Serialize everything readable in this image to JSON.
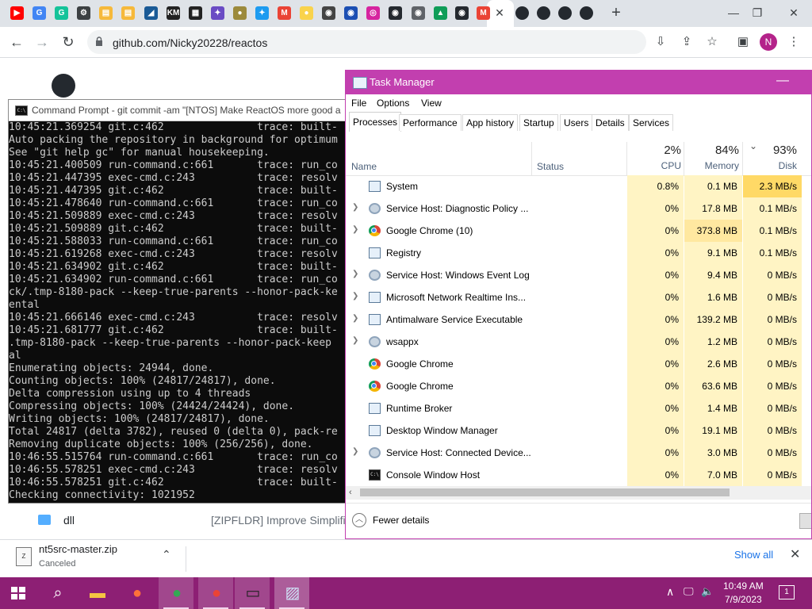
{
  "browser": {
    "tab_icons": [
      {
        "name": "youtube-icon",
        "color": "#ff0000",
        "glyph": "▶"
      },
      {
        "name": "google-icon",
        "color": "#4285f4",
        "glyph": "G"
      },
      {
        "name": "grammarly-icon",
        "color": "#15c39a",
        "glyph": "G"
      },
      {
        "name": "settings-icon",
        "color": "#3c4043",
        "glyph": "⚙"
      },
      {
        "name": "folder-icon",
        "color": "#f6b93b",
        "glyph": "▤"
      },
      {
        "name": "folder-icon",
        "color": "#f6b93b",
        "glyph": "▤"
      },
      {
        "name": "app-icon",
        "color": "#1a5a96",
        "glyph": "◢"
      },
      {
        "name": "kim-icon",
        "color": "#222222",
        "glyph": "KM"
      },
      {
        "name": "qr-icon",
        "color": "#222222",
        "glyph": "▦"
      },
      {
        "name": "star-icon",
        "color": "#6a4bc4",
        "glyph": "✦"
      },
      {
        "name": "hub-icon",
        "color": "#9c8a3c",
        "glyph": "●"
      },
      {
        "name": "twitter-icon",
        "color": "#1d9bf0",
        "glyph": "✦"
      },
      {
        "name": "gmail-icon",
        "color": "#ea4335",
        "glyph": "M"
      },
      {
        "name": "bulb-icon",
        "color": "#f9d34c",
        "glyph": "●"
      },
      {
        "name": "game-icon",
        "color": "#444444",
        "glyph": "◉"
      },
      {
        "name": "sonic-icon",
        "color": "#1c4fb3",
        "glyph": "◉"
      },
      {
        "name": "instagram-icon",
        "color": "#d6249f",
        "glyph": "◎"
      },
      {
        "name": "github-icon",
        "color": "#24292f",
        "glyph": "◉"
      },
      {
        "name": "chrome-icon",
        "color": "#5f6368",
        "glyph": "◉"
      },
      {
        "name": "drive-icon",
        "color": "#0f9d58",
        "glyph": "▲"
      },
      {
        "name": "github-icon",
        "color": "#24292f",
        "glyph": "◉"
      },
      {
        "name": "gmail-icon",
        "color": "#ea4335",
        "glyph": "M"
      }
    ],
    "trailing_github_tabs": 4,
    "close_glyph": "✕",
    "new_tab_glyph": "+",
    "window_controls": {
      "minimize": "—",
      "restore": "❐",
      "close": "✕"
    },
    "url": "github.com/Nicky20228/reactos",
    "profile_initial": "N"
  },
  "github": {
    "row_name": "dll",
    "row_commit": "[ZIPFLDR] Improve Simplified Ch"
  },
  "cmd": {
    "title": "Command Prompt - git  commit -am \"[NTOS] Make ReactOS more good a",
    "lines": [
      "10:45:21.369254 git.c:462               trace: built-",
      "Auto packing the repository in background for optimum",
      "See \"git help gc\" for manual housekeeping.",
      "10:45:21.400509 run-command.c:661       trace: run_co",
      "10:45:21.447395 exec-cmd.c:243          trace: resolv",
      "10:45:21.447395 git.c:462               trace: built-",
      "10:45:21.478640 run-command.c:661       trace: run_co",
      "10:45:21.509889 exec-cmd.c:243          trace: resolv",
      "10:45:21.509889 git.c:462               trace: built-",
      "10:45:21.588033 run-command.c:661       trace: run_co",
      "10:45:21.619268 exec-cmd.c:243          trace: resolv",
      "10:45:21.634902 git.c:462               trace: built-",
      "10:45:21.634902 run-command.c:661       trace: run_co",
      "ck/.tmp-8180-pack --keep-true-parents --honor-pack-ke",
      "ental",
      "10:45:21.666146 exec-cmd.c:243          trace: resolv",
      "10:45:21.681777 git.c:462               trace: built-",
      ".tmp-8180-pack --keep-true-parents --honor-pack-keep ",
      "al",
      "Enumerating objects: 24944, done.",
      "Counting objects: 100% (24817/24817), done.",
      "Delta compression using up to 4 threads",
      "Compressing objects: 100% (24424/24424), done.",
      "Writing objects: 100% (24817/24817), done.",
      "Total 24817 (delta 3782), reused 0 (delta 0), pack-re",
      "Removing duplicate objects: 100% (256/256), done.",
      "10:46:55.515764 run-command.c:661       trace: run_co",
      "10:46:55.578251 exec-cmd.c:243          trace: resolv",
      "10:46:55.578251 git.c:462               trace: built-",
      "Checking connectivity: 1021952"
    ]
  },
  "taskmanager": {
    "title": "Task Manager",
    "minimize_glyph": "—",
    "menu": [
      "File",
      "Options",
      "View"
    ],
    "tabs": [
      "Processes",
      "Performance",
      "App history",
      "Startup",
      "Users",
      "Details",
      "Services"
    ],
    "active_tab": "Processes",
    "columns": {
      "name": "Name",
      "status": "Status",
      "cpu_label": "CPU",
      "cpu_pct": "2%",
      "memory_label": "Memory",
      "memory_pct": "84%",
      "disk_label": "Disk",
      "disk_pct": "93%",
      "sort_glyph": "⌄"
    },
    "processes": [
      {
        "name": "System",
        "expandable": false,
        "icon": "win",
        "cpu": "0.8%",
        "memory": "0.1 MB",
        "disk": "2.3 MB/s",
        "cpu_bg": "#fff4c4",
        "mem_bg": "#fff4c4",
        "disk_bg": "#ffd966"
      },
      {
        "name": "Service Host: Diagnostic Policy ...",
        "expandable": true,
        "icon": "gear",
        "cpu": "0%",
        "memory": "17.8 MB",
        "disk": "0.1 MB/s",
        "cpu_bg": "#fff4c4",
        "mem_bg": "#fff4c4",
        "disk_bg": "#fff4c4"
      },
      {
        "name": "Google Chrome (10)",
        "expandable": true,
        "icon": "chrome",
        "cpu": "0%",
        "memory": "373.8 MB",
        "disk": "0.1 MB/s",
        "cpu_bg": "#fff4c4",
        "mem_bg": "#ffe8a0",
        "disk_bg": "#fff4c4"
      },
      {
        "name": "Registry",
        "expandable": false,
        "icon": "win",
        "cpu": "0%",
        "memory": "9.1 MB",
        "disk": "0.1 MB/s",
        "cpu_bg": "#fff4c4",
        "mem_bg": "#fff4c4",
        "disk_bg": "#fff4c4"
      },
      {
        "name": "Service Host: Windows Event Log",
        "expandable": true,
        "icon": "gear",
        "cpu": "0%",
        "memory": "9.4 MB",
        "disk": "0 MB/s",
        "cpu_bg": "#fff4c4",
        "mem_bg": "#fff4c4",
        "disk_bg": "#fff4c4"
      },
      {
        "name": "Microsoft Network Realtime Ins...",
        "expandable": true,
        "icon": "win",
        "cpu": "0%",
        "memory": "1.6 MB",
        "disk": "0 MB/s",
        "cpu_bg": "#fff4c4",
        "mem_bg": "#fff4c4",
        "disk_bg": "#fff4c4"
      },
      {
        "name": "Antimalware Service Executable",
        "expandable": true,
        "icon": "win",
        "cpu": "0%",
        "memory": "139.2 MB",
        "disk": "0 MB/s",
        "cpu_bg": "#fff4c4",
        "mem_bg": "#fff4c4",
        "disk_bg": "#fff4c4"
      },
      {
        "name": "wsappx",
        "expandable": true,
        "icon": "gear",
        "cpu": "0%",
        "memory": "1.2 MB",
        "disk": "0 MB/s",
        "cpu_bg": "#fff4c4",
        "mem_bg": "#fff4c4",
        "disk_bg": "#fff4c4"
      },
      {
        "name": "Google Chrome",
        "expandable": false,
        "icon": "chrome",
        "cpu": "0%",
        "memory": "2.6 MB",
        "disk": "0 MB/s",
        "cpu_bg": "#fff4c4",
        "mem_bg": "#fff4c4",
        "disk_bg": "#fff4c4"
      },
      {
        "name": "Google Chrome",
        "expandable": false,
        "icon": "chrome",
        "cpu": "0%",
        "memory": "63.6 MB",
        "disk": "0 MB/s",
        "cpu_bg": "#fff4c4",
        "mem_bg": "#fff4c4",
        "disk_bg": "#fff4c4"
      },
      {
        "name": "Runtime Broker",
        "expandable": false,
        "icon": "win",
        "cpu": "0%",
        "memory": "1.4 MB",
        "disk": "0 MB/s",
        "cpu_bg": "#fff4c4",
        "mem_bg": "#fff4c4",
        "disk_bg": "#fff4c4"
      },
      {
        "name": "Desktop Window Manager",
        "expandable": false,
        "icon": "win",
        "cpu": "0%",
        "memory": "19.1 MB",
        "disk": "0 MB/s",
        "cpu_bg": "#fff4c4",
        "mem_bg": "#fff4c4",
        "disk_bg": "#fff4c4"
      },
      {
        "name": "Service Host: Connected Device...",
        "expandable": true,
        "icon": "gear",
        "cpu": "0%",
        "memory": "3.0 MB",
        "disk": "0 MB/s",
        "cpu_bg": "#fff4c4",
        "mem_bg": "#fff4c4",
        "disk_bg": "#fff4c4"
      },
      {
        "name": "Console Window Host",
        "expandable": false,
        "icon": "console",
        "cpu": "0%",
        "memory": "7.0 MB",
        "disk": "0 MB/s",
        "cpu_bg": "#fff4c4",
        "mem_bg": "#fff4c4",
        "disk_bg": "#fff4c4"
      }
    ],
    "fewer_details": "Fewer details"
  },
  "downloads": {
    "file_name": "nt5src-master.zip",
    "status": "Canceled",
    "show_all": "Show all",
    "close_glyph": "✕",
    "chevron_glyph": "⌃"
  },
  "taskbar": {
    "apps": [
      {
        "name": "search-icon",
        "glyph": "⌕",
        "color": "#ffffff"
      },
      {
        "name": "file-explorer-icon",
        "glyph": "▬",
        "color": "#f4c542"
      },
      {
        "name": "firefox-icon",
        "glyph": "●",
        "color": "#ff7139"
      },
      {
        "name": "chrome-profile-icon",
        "glyph": "●",
        "color": "#34a853"
      },
      {
        "name": "chrome-profile-n-icon",
        "glyph": "●",
        "color": "#ea4335"
      },
      {
        "name": "command-prompt-icon",
        "glyph": "▭",
        "color": "#222222"
      },
      {
        "name": "task-manager-icon",
        "glyph": "▨",
        "color": "#cfe3f7"
      }
    ],
    "tray_chevron": "∧",
    "tray_network": "🖵",
    "tray_volume": "🔈",
    "time": "10:49 AM",
    "date": "7/9/2023",
    "notification_count": "1"
  }
}
